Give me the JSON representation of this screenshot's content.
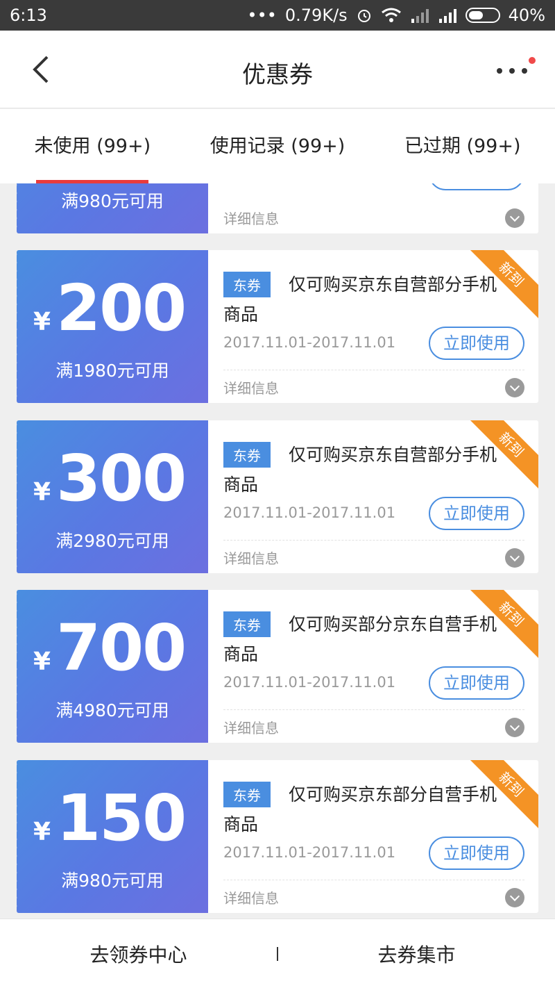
{
  "status": {
    "time": "6:13",
    "dots": "•••",
    "speed": "0.79K/s",
    "battery_text": "40%"
  },
  "header": {
    "title": "优惠券",
    "back_icon": "chevron-left-icon",
    "more_icon": "more-dots-icon"
  },
  "tabs": [
    {
      "label": "未使用 (99+)",
      "active": true
    },
    {
      "label": "使用记录 (99+)",
      "active": false
    },
    {
      "label": "已过期 (99+)",
      "active": false
    }
  ],
  "coupons": [
    {
      "currency": "¥",
      "amount": "",
      "condition": "满980元可用",
      "tag": "",
      "description": "",
      "dates": "",
      "use_label": "",
      "detail_label": "详细信息",
      "ribbon": ""
    },
    {
      "currency": "¥",
      "amount": "200",
      "condition": "满1980元可用",
      "tag": "东券",
      "description": "仅可购买京东自营部分手机商品",
      "dates": "2017.11.01-2017.11.01",
      "use_label": "立即使用",
      "detail_label": "详细信息",
      "ribbon": "新到"
    },
    {
      "currency": "¥",
      "amount": "300",
      "condition": "满2980元可用",
      "tag": "东券",
      "description": "仅可购买京东自营部分手机商品",
      "dates": "2017.11.01-2017.11.01",
      "use_label": "立即使用",
      "detail_label": "详细信息",
      "ribbon": "新到"
    },
    {
      "currency": "¥",
      "amount": "700",
      "condition": "满4980元可用",
      "tag": "东券",
      "description": "仅可购买部分京东自营手机商品",
      "dates": "2017.11.01-2017.11.01",
      "use_label": "立即使用",
      "detail_label": "详细信息",
      "ribbon": "新到"
    },
    {
      "currency": "¥",
      "amount": "150",
      "condition": "满980元可用",
      "tag": "东券",
      "description": "仅可购买京东部分自营手机商品",
      "dates": "2017.11.01-2017.11.01",
      "use_label": "立即使用",
      "detail_label": "详细信息",
      "ribbon": "新到"
    }
  ],
  "bottom": {
    "left_label": "去领券中心",
    "separator": "I",
    "right_label": "去券集市"
  },
  "colors": {
    "accent_blue": "#4a8ee0",
    "tab_indicator": "#e93b3d",
    "ribbon_orange": "#f49325"
  }
}
